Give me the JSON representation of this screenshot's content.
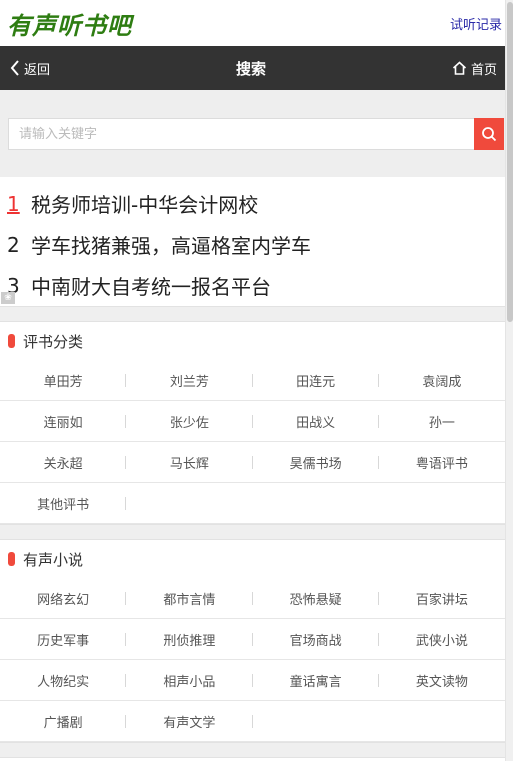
{
  "site": {
    "logo": "有声听书吧",
    "history_link": "试听记录"
  },
  "navbar": {
    "back_label": "返回",
    "title": "搜索",
    "home_label": "首页"
  },
  "search": {
    "placeholder": "请输入关键字",
    "value": ""
  },
  "ads": [
    {
      "num": "1",
      "text": "税务师培训-中华会计网校"
    },
    {
      "num": "2",
      "text": "学车找猪兼强，高逼格室内学车"
    },
    {
      "num": "3",
      "text": "中南财大自考统一报名平台"
    }
  ],
  "sections": [
    {
      "title": "评书分类",
      "items": [
        "单田芳",
        "刘兰芳",
        "田连元",
        "袁阔成",
        "连丽如",
        "张少佐",
        "田战义",
        "孙一",
        "关永超",
        "马长辉",
        "昊儒书场",
        "粤语评书",
        "其他评书"
      ]
    },
    {
      "title": "有声小说",
      "items": [
        "网络玄幻",
        "都市言情",
        "恐怖悬疑",
        "百家讲坛",
        "历史军事",
        "刑侦推理",
        "官场商战",
        "武侠小说",
        "人物纪实",
        "相声小品",
        "童话寓言",
        "英文读物",
        "广播剧",
        "有声文学"
      ]
    }
  ],
  "colors": {
    "logo": "#2e7d12",
    "navbar_bg": "#333333",
    "accent": "#f04a3c",
    "link": "#2a2aa8"
  }
}
